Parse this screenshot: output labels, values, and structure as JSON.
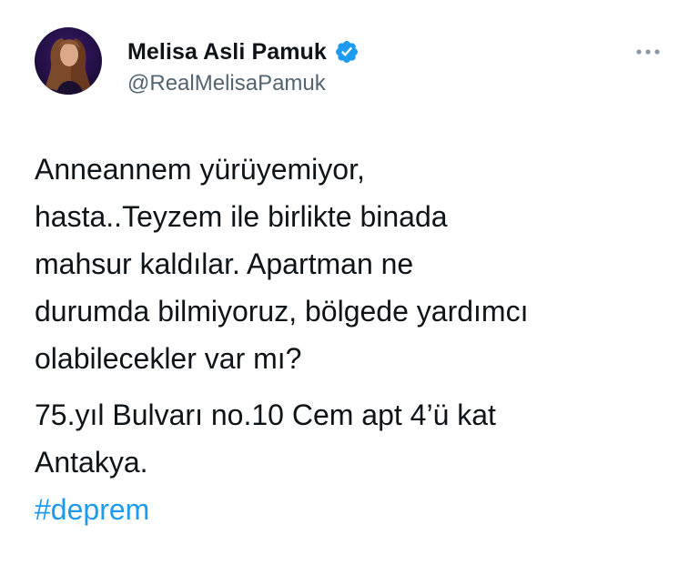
{
  "tweet": {
    "author": {
      "display_name": "Melisa Asli Pamuk",
      "handle": "@RealMelisaPamuk",
      "verified": true,
      "avatar": "profile-photo"
    },
    "more_icon": "more-horizontal-icon",
    "text": {
      "paragraph1_lines": [
        "Anneannem yürüyemiyor,",
        "hasta..Teyzem ile birlikte binada",
        "mahsur kaldılar. Apartman ne",
        "durumda bilmiyoruz, bölgede yardımcı",
        "olabilecekler var mı?"
      ],
      "paragraph2_lines": [
        "75.yıl Bulvarı no.10 Cem apt 4’ü kat",
        "Antakya."
      ],
      "hashtag": "#deprem"
    },
    "colors": {
      "text": "#0f1419",
      "secondary": "#536471",
      "accent": "#1d9bf0"
    }
  }
}
